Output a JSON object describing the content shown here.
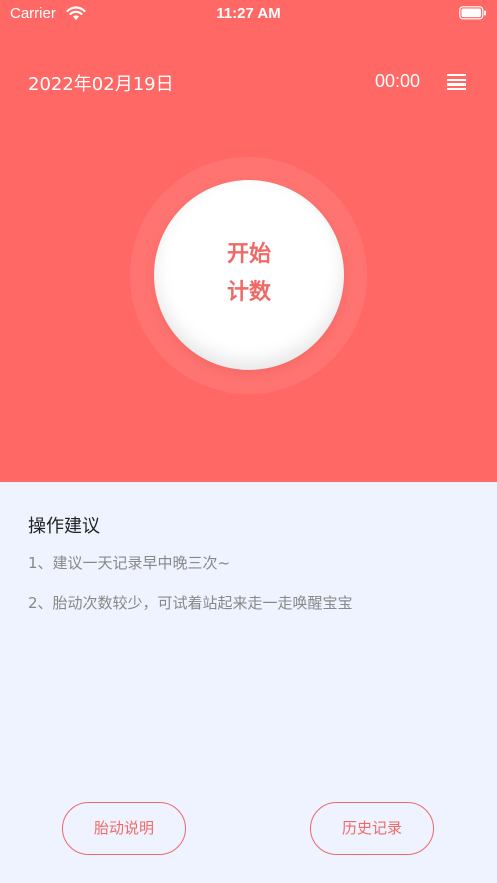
{
  "status_bar": {
    "carrier": "Carrier",
    "time": "11:27 AM"
  },
  "header": {
    "date": "2022年02月19日",
    "timer": "00:00",
    "menu_icon": "menu-lines-icon"
  },
  "counter": {
    "line1": "开始",
    "line2": "计数"
  },
  "tips": {
    "title": "操作建议",
    "items": [
      "1、建议一天记录早中晚三次~",
      "2、胎动次数较少，可试着站起来走一走唤醒宝宝"
    ]
  },
  "buttons": {
    "left": "胎动说明",
    "right": "历史记录"
  },
  "colors": {
    "primary": "#ff6865",
    "accent_text": "#ef6a67",
    "background": "#eef3ff"
  }
}
